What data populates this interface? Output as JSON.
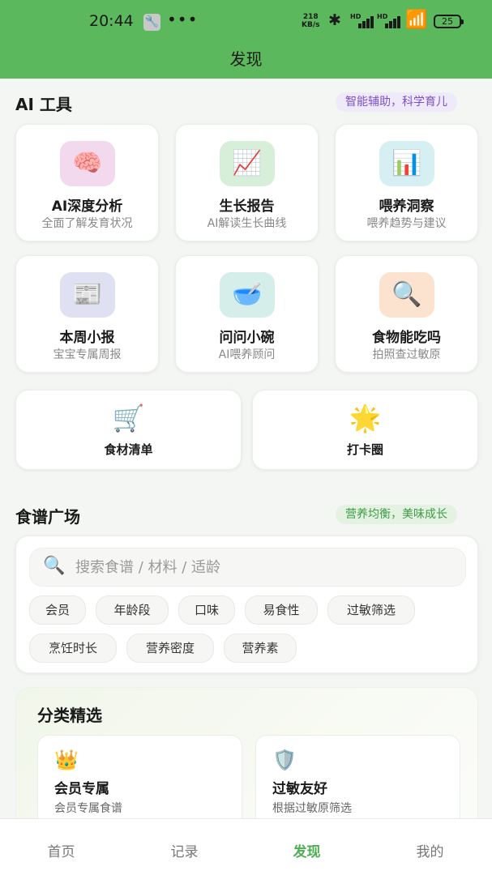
{
  "status_bar": {
    "time": "20:44",
    "dots": "•••",
    "net_speed_value": "218",
    "net_speed_unit": "KB/s",
    "hd1": "HD",
    "hd2": "HD",
    "battery": "25"
  },
  "header": {
    "title": "发现"
  },
  "ai_tools": {
    "title": "AI 工具",
    "tagline": "智能辅助，科学育儿",
    "tools": [
      {
        "icon": "🧠",
        "title": "AI深度分析",
        "subtitle": "全面了解发育状况"
      },
      {
        "icon": "📈",
        "title": "生长报告",
        "subtitle": "AI解读生长曲线"
      },
      {
        "icon": "📊",
        "title": "喂养洞察",
        "subtitle": "喂养趋势与建议"
      },
      {
        "icon": "📰",
        "title": "本周小报",
        "subtitle": "宝宝专属周报"
      },
      {
        "icon": "🥣",
        "title": "问问小碗",
        "subtitle": "AI喂养顾问"
      },
      {
        "icon": "🔍",
        "title": "食物能吃吗",
        "subtitle": "拍照查过敏原"
      }
    ],
    "wide": [
      {
        "icon": "🛒",
        "title": "食材清单"
      },
      {
        "icon": "🌟",
        "title": "打卡圈"
      }
    ]
  },
  "recipes": {
    "title": "食谱广场",
    "tagline": "营养均衡，美味成长",
    "search_placeholder": "搜索食谱 / 材料 / 适龄",
    "filters": [
      "会员",
      "年龄段",
      "口味",
      "易食性",
      "过敏筛选",
      "烹饪时长",
      "营养密度",
      "营养素"
    ]
  },
  "categories": {
    "title": "分类精选",
    "items": [
      {
        "icon": "👑",
        "name": "会员专属",
        "desc": "会员专属食谱"
      },
      {
        "icon": "🛡️",
        "name": "过敏友好",
        "desc": "根据过敏原筛选"
      }
    ]
  },
  "tabbar": {
    "tabs": [
      "首页",
      "记录",
      "发现",
      "我的"
    ],
    "active": "发现"
  },
  "colors": {
    "header_green": "#5cb85c",
    "active_tab": "#4caf50",
    "tagline_purple": "#7d50cf",
    "tagline_green": "#3e9a46"
  }
}
